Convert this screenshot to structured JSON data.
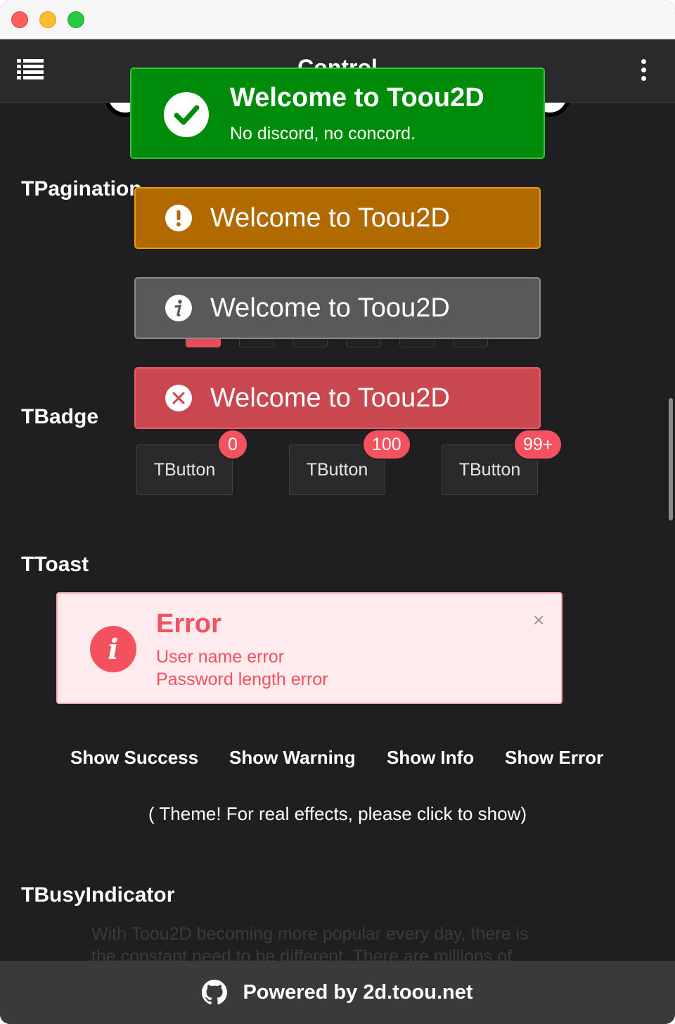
{
  "window": {
    "traffic_lights": [
      "close",
      "minimize",
      "zoom"
    ]
  },
  "appbar": {
    "title": "Control",
    "menu_icon": "list-icon",
    "more_icon": "more-vertical-icon"
  },
  "sections": {
    "pagination": "TPagination",
    "badge": "TBadge",
    "toast": "TToast",
    "busy": "TBusyIndicator"
  },
  "badges": [
    {
      "button_label": "TButton",
      "badge": "0"
    },
    {
      "button_label": "TButton",
      "badge": "100"
    },
    {
      "button_label": "TButton",
      "badge": "99+"
    }
  ],
  "toast_error": {
    "title": "Error",
    "line1": "User name error",
    "line2": "Password length error",
    "close": "×",
    "icon": "info-icon"
  },
  "toast_buttons": {
    "success": "Show Success",
    "warning": "Show Warning",
    "info": "Show Info",
    "error": "Show Error"
  },
  "toast_note": "( Theme! For real effects, please click to show)",
  "busy_text": {
    "line1": "With Toou2D becoming more popular every day, there is",
    "line2": "the constant need to be different. There are millions of"
  },
  "footer": {
    "text": "Powered by 2d.toou.net",
    "icon": "github-icon"
  },
  "notifications": {
    "success": {
      "title": "Welcome to Toou2D",
      "message": "No discord, no concord.",
      "icon": "check-icon"
    },
    "warning": {
      "text": "Welcome to Toou2D",
      "icon": "exclamation-icon"
    },
    "info": {
      "text": "Welcome to Toou2D",
      "icon": "info-icon"
    },
    "error": {
      "text": "Welcome to Toou2D",
      "icon": "x-icon"
    }
  },
  "colors": {
    "success": "#008c0b",
    "warning": "#b06a00",
    "info": "#59595c",
    "error": "#c9474f",
    "badge": "#f5525f",
    "pager_active": "#e74d5a"
  }
}
